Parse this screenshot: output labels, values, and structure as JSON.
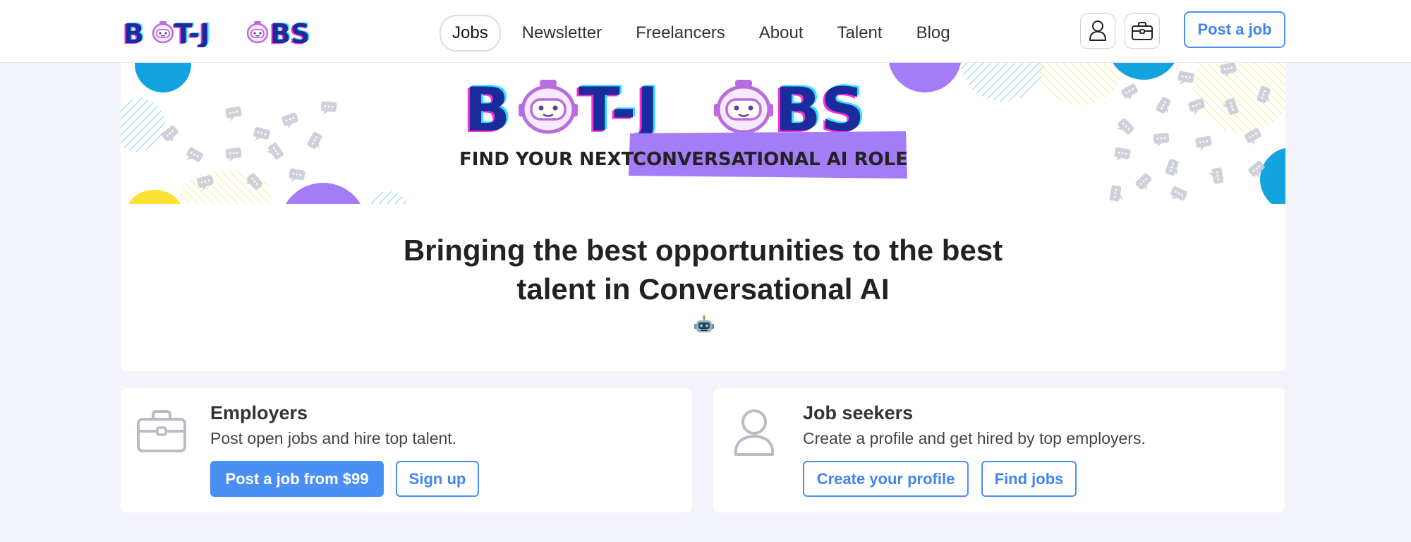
{
  "nav": {
    "logo_text": "BOT-JOBS",
    "links": [
      {
        "label": "Jobs",
        "active": true
      },
      {
        "label": "Newsletter",
        "active": false
      },
      {
        "label": "Freelancers",
        "active": false
      },
      {
        "label": "About",
        "active": false
      },
      {
        "label": "Talent",
        "active": false
      },
      {
        "label": "Blog",
        "active": false
      }
    ],
    "icons": [
      "user-icon",
      "briefcase-icon"
    ],
    "post_job_label": "Post a job"
  },
  "hero": {
    "logo_text": "BOT-JOBS",
    "tagline_plain": "FIND YOUR NEXT",
    "tagline_highlight": "CONVERSATIONAL AI ROLE",
    "headline_line1": "Bringing the best opportunities to the best",
    "headline_line2": "talent in Conversational AI",
    "emoji_icon": "robot-icon"
  },
  "cards": {
    "employers": {
      "icon": "briefcase-icon",
      "title": "Employers",
      "description": "Post open jobs and hire top talent.",
      "primary_button": "Post a job from $99",
      "secondary_button": "Sign up"
    },
    "job_seekers": {
      "icon": "user-icon",
      "title": "Job seekers",
      "description": "Create a profile and get hired by top employers.",
      "primary_button": "Create your profile",
      "secondary_button": "Find jobs"
    }
  },
  "colors": {
    "accent_blue": "#4a8ff4",
    "logo_navy": "#1a2b9c",
    "logo_magenta": "#ff2bd6",
    "logo_cyan": "#34e0ff",
    "highlight_purple": "#a57cf7",
    "bubble_blue": "#13a3e0",
    "bubble_yellow": "#ffe135",
    "page_bg": "#f3f4fb"
  }
}
